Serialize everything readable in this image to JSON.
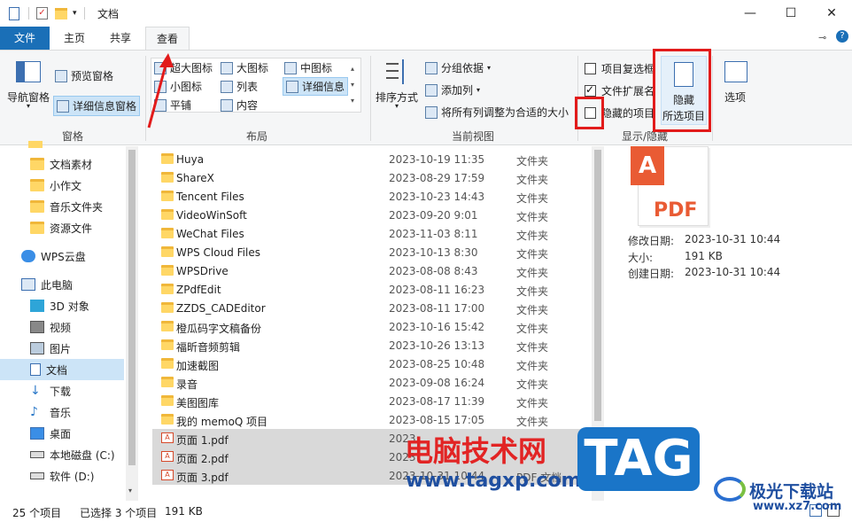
{
  "titlebar": {
    "title": "文档",
    "minimize": "—",
    "maximize": "☐",
    "close": "✕"
  },
  "tabs": {
    "file": "文件",
    "home": "主页",
    "share": "共享",
    "view": "查看"
  },
  "ribbon": {
    "pane_group": {
      "label": "窗格",
      "nav_pane": "导航窗格",
      "preview_pane": "预览窗格",
      "details_pane": "详细信息窗格"
    },
    "layout_group": {
      "label": "布局",
      "extra_large": "超大图标",
      "large": "大图标",
      "medium": "中图标",
      "small": "小图标",
      "list": "列表",
      "details": "详细信息",
      "tiles": "平铺",
      "content": "内容"
    },
    "current_view_group": {
      "label": "当前视图",
      "sort_by": "排序方式",
      "group_by": "分组依据",
      "add_column": "添加列",
      "fit_columns": "将所有列调整为合适的大小"
    },
    "show_hide_group": {
      "label": "显示/隐藏",
      "item_checkboxes": "项目复选框",
      "file_extensions": "文件扩展名",
      "hidden_items": "隐藏的项目",
      "hide_selected_line1": "隐藏",
      "hide_selected_line2": "所选项目"
    },
    "options": "选项"
  },
  "nav": {
    "items": [
      {
        "label": "文档素材"
      },
      {
        "label": "小作文"
      },
      {
        "label": "音乐文件夹"
      },
      {
        "label": "资源文件"
      },
      {
        "label": "WPS云盘"
      },
      {
        "label": "此电脑"
      },
      {
        "label": "3D 对象"
      },
      {
        "label": "视频"
      },
      {
        "label": "图片"
      },
      {
        "label": "文档"
      },
      {
        "label": "下载"
      },
      {
        "label": "音乐"
      },
      {
        "label": "桌面"
      },
      {
        "label": "本地磁盘 (C:)"
      },
      {
        "label": "软件 (D:)"
      }
    ]
  },
  "files": [
    {
      "name": "Huya",
      "date": "2023-10-19 11:35",
      "type": "文件夹"
    },
    {
      "name": "ShareX",
      "date": "2023-08-29 17:59",
      "type": "文件夹"
    },
    {
      "name": "Tencent Files",
      "date": "2023-10-23 14:43",
      "type": "文件夹"
    },
    {
      "name": "VideoWinSoft",
      "date": "2023-09-20 9:01",
      "type": "文件夹"
    },
    {
      "name": "WeChat Files",
      "date": "2023-11-03 8:11",
      "type": "文件夹"
    },
    {
      "name": "WPS Cloud Files",
      "date": "2023-10-13 8:30",
      "type": "文件夹"
    },
    {
      "name": "WPSDrive",
      "date": "2023-08-08 8:43",
      "type": "文件夹"
    },
    {
      "name": "ZPdfEdit",
      "date": "2023-08-11 16:23",
      "type": "文件夹"
    },
    {
      "name": "ZZDS_CADEditor",
      "date": "2023-08-11 17:00",
      "type": "文件夹"
    },
    {
      "name": "橙瓜码字文稿备份",
      "date": "2023-10-16 15:42",
      "type": "文件夹"
    },
    {
      "name": "福昕音频剪辑",
      "date": "2023-10-26 13:13",
      "type": "文件夹"
    },
    {
      "name": "加速截图",
      "date": "2023-08-25 10:48",
      "type": "文件夹"
    },
    {
      "name": "录音",
      "date": "2023-09-08 16:24",
      "type": "文件夹"
    },
    {
      "name": "美图图库",
      "date": "2023-08-17 11:39",
      "type": "文件夹"
    },
    {
      "name": "我的 memoQ 项目",
      "date": "2023-08-15 17:05",
      "type": "文件夹"
    },
    {
      "name": "页面 1.pdf",
      "date": "2023",
      "type": ""
    },
    {
      "name": "页面 2.pdf",
      "date": "2023",
      "type": ""
    },
    {
      "name": "页面 3.pdf",
      "date": "2023-10-31 10:44",
      "type": "PDF 文档"
    }
  ],
  "preview": {
    "pdf_label": "PDF",
    "modified_label": "修改日期:",
    "modified_value": "2023-10-31 10:44",
    "size_label": "大小:",
    "size_value": "191 KB",
    "created_label": "创建日期:",
    "created_value": "2023-10-31 10:44"
  },
  "status": {
    "count": "25 个项目",
    "selected": "已选择 3 个项目",
    "size": "191 KB"
  },
  "watermark": {
    "site_cn": "电脑技术网",
    "site_url": "www.tagxp.com",
    "tag": "TAG",
    "brand2": "极光下载站",
    "brand2_url": "www.xz7.com"
  },
  "colors": {
    "accent": "#1a6fb7",
    "highlight": "#e21b1b",
    "selected_nav": "#cce4f7"
  }
}
